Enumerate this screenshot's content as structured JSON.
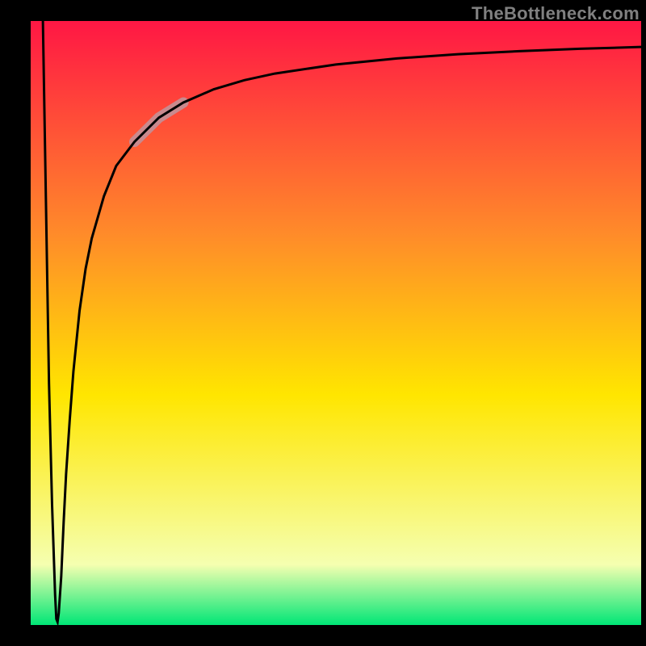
{
  "watermark": "TheBottleneck.com",
  "colors": {
    "frame": "#000000",
    "watermark": "#808080",
    "curve": "#000000",
    "highlight": "#c98a8e",
    "gradient_top": "#ff1744",
    "gradient_mid_upper": "#ff8a2a",
    "gradient_mid": "#ffe600",
    "gradient_mid_lower": "#f5ffb0",
    "gradient_bottom": "#00e676"
  },
  "chart_data": {
    "type": "line",
    "title": "",
    "xlabel": "",
    "ylabel": "",
    "xlim": [
      0,
      100
    ],
    "ylim": [
      0,
      100
    ],
    "x": [
      2,
      2.5,
      3,
      3.5,
      4,
      4.2,
      4.4,
      4.6,
      5,
      5.4,
      5.8,
      6.4,
      7,
      8,
      9,
      10,
      12,
      14,
      17,
      21,
      25,
      30,
      35,
      40,
      50,
      60,
      70,
      80,
      90,
      100
    ],
    "values": [
      100,
      70,
      40,
      20,
      5,
      1,
      0.5,
      2,
      8,
      17,
      25,
      34,
      42,
      52,
      59,
      64,
      71,
      76,
      80,
      84,
      86.5,
      88.7,
      90.2,
      91.3,
      92.8,
      93.8,
      94.5,
      95,
      95.4,
      95.7
    ],
    "annotations": [
      {
        "name": "highlight-segment",
        "x_range": [
          17,
          25
        ],
        "y_range": [
          80,
          86.5
        ]
      }
    ]
  }
}
